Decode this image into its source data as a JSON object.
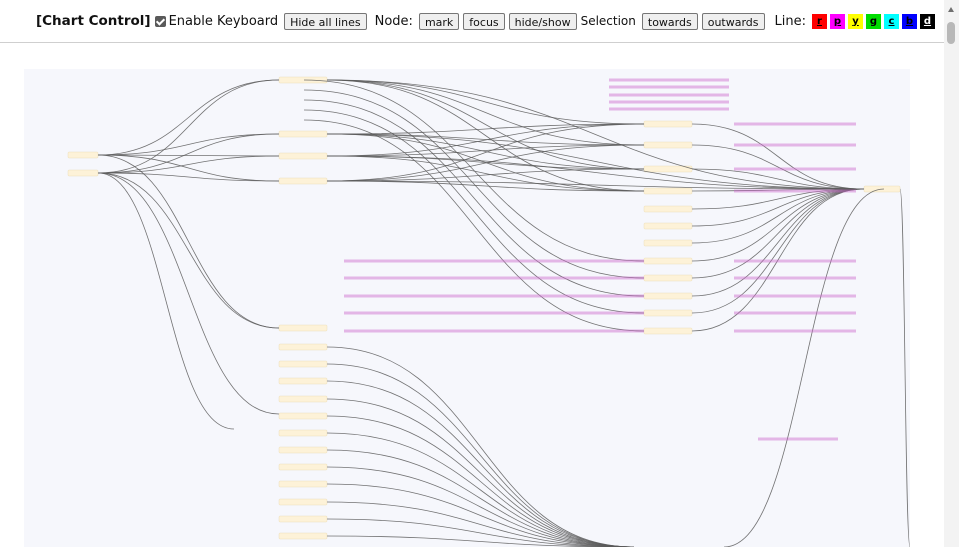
{
  "toolbar": {
    "title": "[Chart Control]",
    "enable_keyboard_label": "Enable Keyboard",
    "hide_all_lines": "Hide all lines",
    "node_label": "Node:",
    "mark": "mark",
    "focus": "focus",
    "hide_show": "hide/show",
    "selection_label": "Selection",
    "towards": "towards",
    "outwards": "outwards",
    "line_label": "Line:"
  },
  "line_colors": [
    {
      "key": "r",
      "color": "#ff0000",
      "text": "#000000"
    },
    {
      "key": "p",
      "color": "#ff00ff",
      "text": "#000000"
    },
    {
      "key": "y",
      "color": "#ffff00",
      "text": "#000000"
    },
    {
      "key": "g",
      "color": "#00dd00",
      "text": "#000000"
    },
    {
      "key": "c",
      "color": "#00ffff",
      "text": "#000000"
    },
    {
      "key": "b",
      "color": "#0000ff",
      "text": "#000000"
    },
    {
      "key": "d",
      "color": "#000000",
      "text": "#ffffff"
    }
  ],
  "graph": {
    "node_color": "#fdf2d8",
    "edge_color": "#5a5a5a",
    "label_color": "#cc66cc"
  }
}
